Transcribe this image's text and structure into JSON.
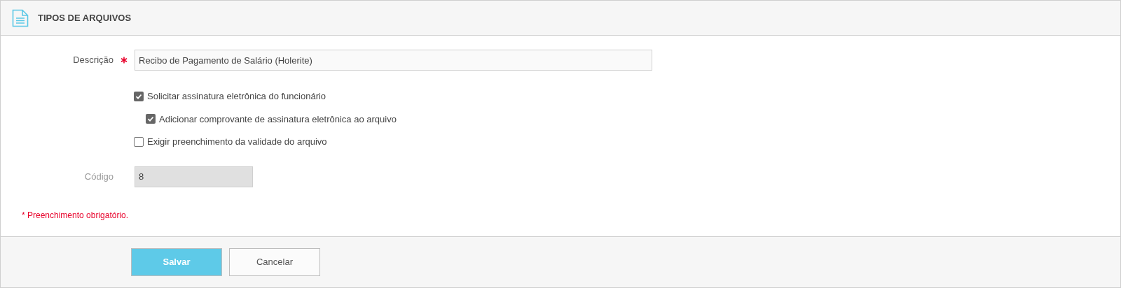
{
  "header": {
    "title": "TIPOS DE ARQUIVOS"
  },
  "fields": [
    {
      "label": "Descrição",
      "required": true,
      "value": "Recibo de Pagamento de Salário (Holerite)",
      "disabled": false
    },
    {
      "label": "Código",
      "required": false,
      "value": "8",
      "disabled": true
    }
  ],
  "options": [
    {
      "label": "Solicitar assinatura eletrônica do funcionário",
      "checked": true,
      "children": [
        {
          "label": "Adicionar comprovante de assinatura eletrônica ao arquivo",
          "checked": true
        }
      ]
    },
    {
      "label": "Exigir preenchimento da validade do arquivo",
      "checked": false
    }
  ],
  "required_note": "* Preenchimento obrigatório.",
  "buttons": [
    {
      "label": "Salvar",
      "kind": "primary"
    },
    {
      "label": "Cancelar",
      "kind": "secondary"
    }
  ]
}
